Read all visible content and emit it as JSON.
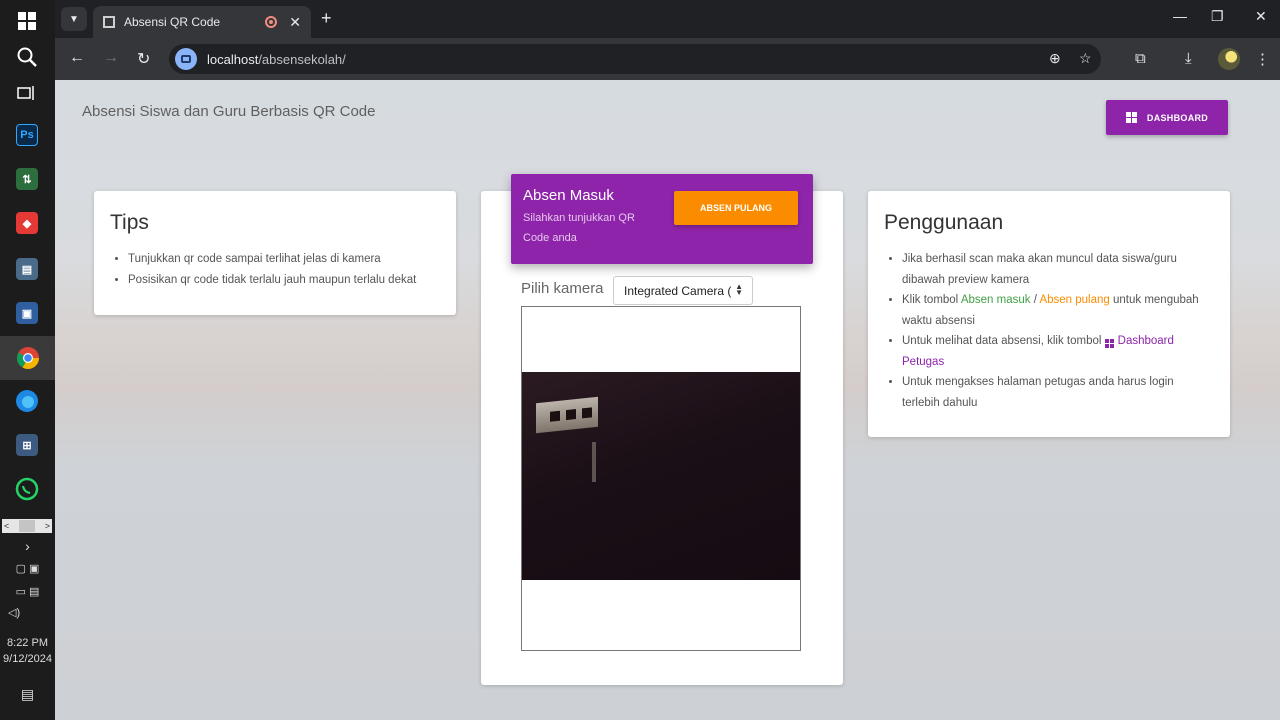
{
  "taskbar": {
    "icons": [
      "search-icon",
      "task-view-icon",
      "photoshop-icon",
      "file-transfer-icon",
      "anydesk-icon",
      "printer-icon",
      "network-settings-icon",
      "chrome-icon",
      "edge-icon",
      "network-icon",
      "whatsapp-icon"
    ],
    "time": "8:22 PM",
    "date": "9/12/2024"
  },
  "browser": {
    "tab_title": "Absensi QR Code",
    "url_host": "localhost",
    "url_path": "/absensekolah/"
  },
  "page": {
    "app_title": "Absensi Siswa dan Guru Berbasis QR Code",
    "dashboard_button": "DASHBOARD",
    "tips": {
      "title": "Tips",
      "items": [
        "Tunjukkan qr code sampai terlihat jelas di kamera",
        "Posisikan qr code tidak terlalu jauh maupun terlalu dekat"
      ]
    },
    "scan": {
      "title": "Absen Masuk",
      "subtitle": "Silahkan tunjukkan QR Code anda",
      "switch_button": "ABSEN PULANG",
      "camera_label": "Pilih kamera",
      "camera_selected": "Integrated Camera ("
    },
    "usage": {
      "title": "Penggunaan",
      "item1": "Jika berhasil scan maka akan muncul data siswa/guru dibawah preview kamera",
      "item2_pre": "Klik tombol ",
      "item2_link1": "Absen masuk",
      "item2_sep": " / ",
      "item2_link2": "Absen pulang",
      "item2_post": " untuk mengubah waktu absensi",
      "item3_pre": "Untuk melihat data absensi, klik tombol ",
      "item3_link": "Dashboard Petugas",
      "item4": "Untuk mengakses halaman petugas anda harus login terlebih dahulu"
    }
  },
  "colors": {
    "primary": "#8e24aa",
    "accent": "#fb8c00",
    "success": "#43a047"
  }
}
